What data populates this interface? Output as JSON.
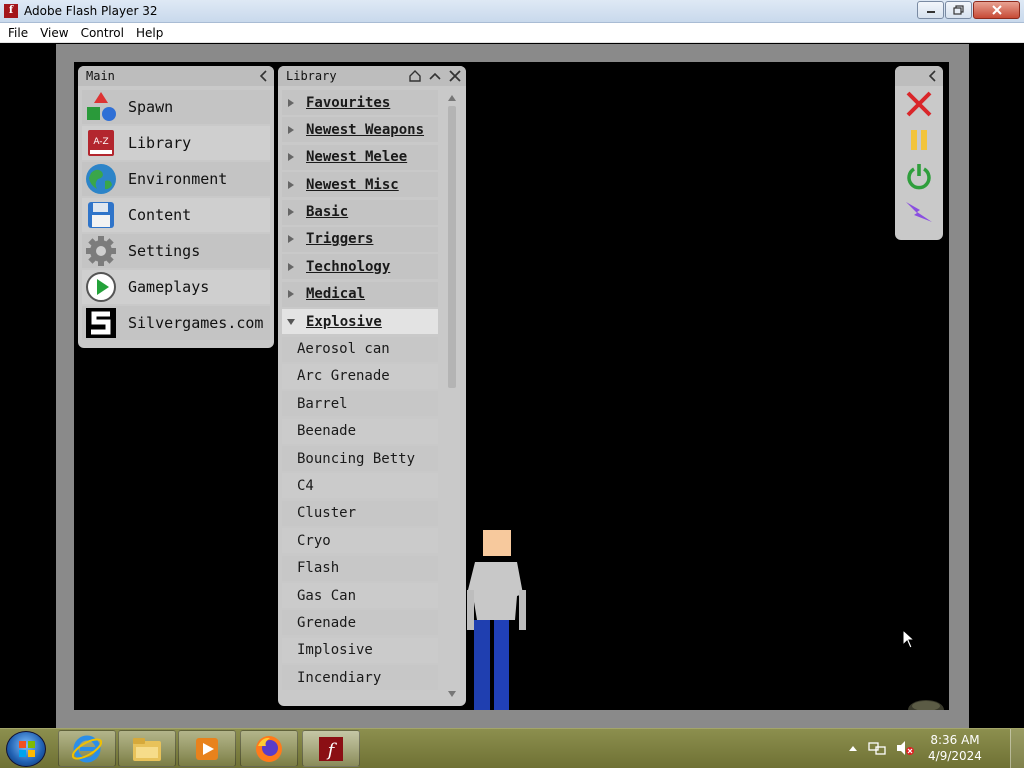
{
  "window": {
    "title": "Adobe Flash Player 32",
    "menu": [
      "File",
      "View",
      "Control",
      "Help"
    ]
  },
  "main_panel": {
    "title": "Main",
    "items": [
      {
        "label": "Spawn",
        "icon": "shapes-icon"
      },
      {
        "label": "Library",
        "icon": "book-icon"
      },
      {
        "label": "Environment",
        "icon": "globe-icon"
      },
      {
        "label": "Content",
        "icon": "floppy-icon"
      },
      {
        "label": "Settings",
        "icon": "gear-icon"
      },
      {
        "label": "Gameplays",
        "icon": "play-icon"
      },
      {
        "label": "Silvergames.com",
        "icon": "silvergames-logo-icon"
      }
    ]
  },
  "library_panel": {
    "title": "Library",
    "categories": [
      {
        "label": "Favourites"
      },
      {
        "label": "Newest Weapons"
      },
      {
        "label": "Newest Melee"
      },
      {
        "label": "Newest Misc"
      },
      {
        "label": "Basic"
      },
      {
        "label": "Triggers"
      },
      {
        "label": "Technology"
      },
      {
        "label": "Medical"
      },
      {
        "label": "Explosive"
      }
    ],
    "expanded_category": "Explosive",
    "explosive_items": [
      "Aerosol can",
      "Arc Grenade",
      "Barrel",
      "Beenade",
      "Bouncing Betty",
      "C4",
      "Cluster",
      "Cryo",
      "Flash",
      "Gas Can",
      "Grenade",
      "Implosive",
      "Incendiary"
    ]
  },
  "tools_panel": {
    "tools": [
      {
        "icon": "close-x-icon",
        "color": "#d9262a"
      },
      {
        "icon": "pause-icon",
        "color": "#f2c43a"
      },
      {
        "icon": "power-icon",
        "color": "#2f9e3c"
      },
      {
        "icon": "lightning-icon",
        "color": "#8a4fe0"
      }
    ]
  },
  "taskbar": {
    "time": "8:36 AM",
    "date": "4/9/2024"
  },
  "colors": {
    "stage_bg": "#000000",
    "panel_bg": "#c9c9c9",
    "ragdoll_skin": "#f7c99d",
    "ragdoll_shirt": "#c8c8c8",
    "ragdoll_pants": "#1f3fb0"
  }
}
